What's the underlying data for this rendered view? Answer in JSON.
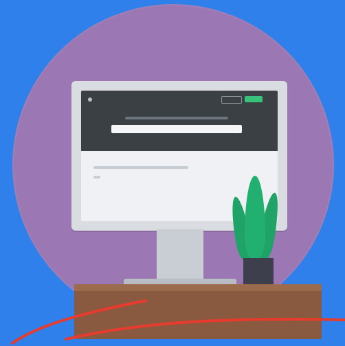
{
  "illustration": {
    "screen": {
      "brand_name": "",
      "nav": {
        "ghost_label": "",
        "primary_label": ""
      }
    }
  },
  "colors": {
    "background": "#2f80ea",
    "circle": "#9b78b3",
    "site_header": "#3b4044",
    "accent_green": "#39c27a",
    "plant": "#22b070",
    "desk": "#8a5a40",
    "stroke": "#e83b2e"
  }
}
